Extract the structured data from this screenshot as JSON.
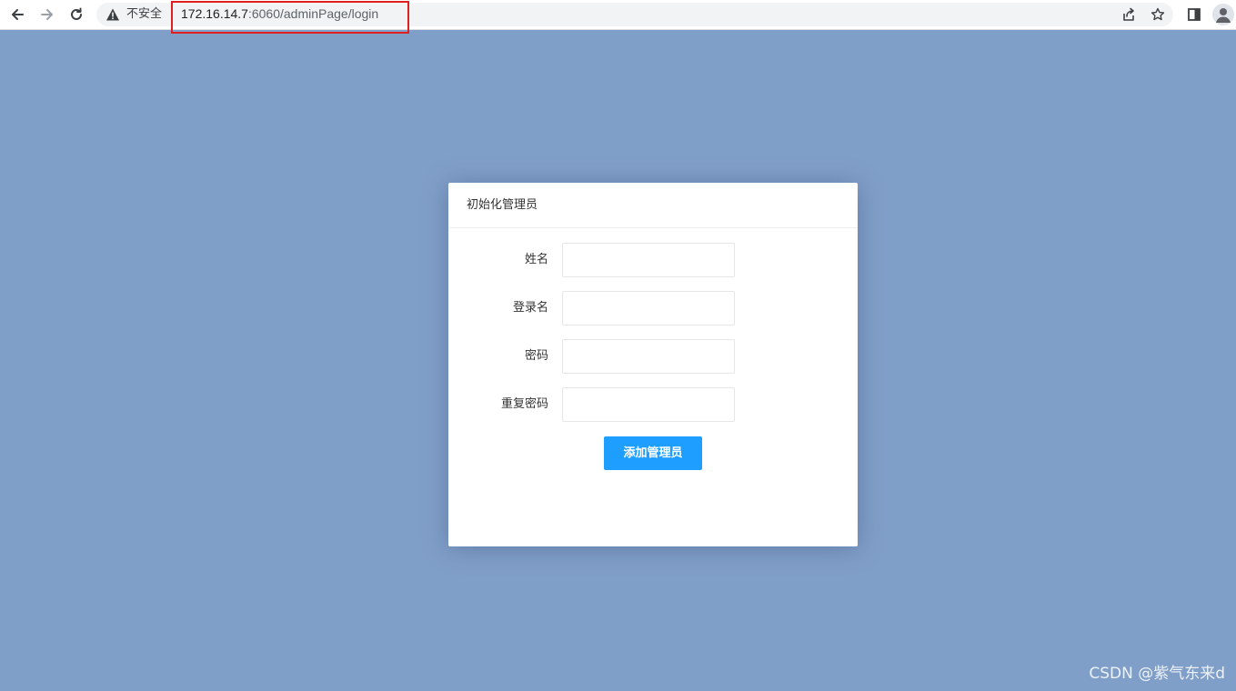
{
  "browser": {
    "security_label": "不安全",
    "url_host": "172.16.14.7",
    "url_rest": ":6060/adminPage/login",
    "icons": [
      "back-arrow-icon",
      "forward-arrow-icon",
      "reload-icon",
      "warning-icon",
      "share-icon",
      "star-icon",
      "sidebar-panel-icon",
      "profile-icon"
    ],
    "highlight_color": "#e0201f"
  },
  "dialog": {
    "title": "初始化管理员",
    "fields": [
      {
        "label": "姓名",
        "value": "",
        "placeholder": ""
      },
      {
        "label": "登录名",
        "value": "",
        "placeholder": ""
      },
      {
        "label": "密码",
        "value": "",
        "placeholder": ""
      },
      {
        "label": "重复密码",
        "value": "",
        "placeholder": ""
      }
    ],
    "submit_label": "添加管理员"
  },
  "watermark": "CSDN @紫气东来d",
  "colors": {
    "page_background": "#809fc8",
    "button": "#1e9fff",
    "dialog_background": "#ffffff"
  }
}
